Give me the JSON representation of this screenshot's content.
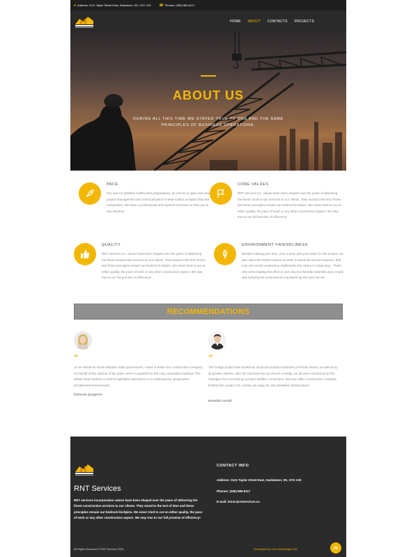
{
  "topbar": {
    "address": "Address: 3121 Taylor Street East, Saskatoon, SK, S7H 1X5",
    "phone": "Phones: (306) 880-8117"
  },
  "nav": {
    "items": [
      {
        "label": "HOME",
        "active": false
      },
      {
        "label": "ABOUT",
        "active": true
      },
      {
        "label": "CONTACTS",
        "active": false
      },
      {
        "label": "PROJECTS",
        "active": false
      }
    ]
  },
  "hero": {
    "title": "ABOUT US",
    "subtitle": "DURING ALL THIS TIME WE STAYED TRUE TO ONE AND THE SAME PRINCIPLES OF BUSINESS OPERATIONS."
  },
  "features": [
    {
      "title": "PACE",
      "icon": "rocket-icon",
      "text": "Our love for detailed, bullet-point preparations, as well as to open and clear project management and communication is what makes us faster than the competition. We have a professional and experienced team to help you in any situation."
    },
    {
      "title": "CORE VALUES",
      "icon": "flag-icon",
      "text": "RNT services Inc. values have been shaped over the years of delivering the finest construction services to our clients. They stood to the test of time and these principles remain our bedrock linchpins. We never tried to cut on either quality, the pace of work or any other construction aspect. We stay true to our full promise of efficiency!"
    },
    {
      "title": "QUALITY",
      "icon": "thumbs-up-icon",
      "text": "RNT services Inc. values have been shaped over the years of delivering the finest construction services to our clients. They stood to the test of time and these principles remain our bedrock linchpins. We never tried to cut on either quality, the pace of work or any other construction aspect. We stay true to our full promise of efficiency!"
    },
    {
      "title": "ENVIRONMENT FRIENDLINESS",
      "icon": "leaf-icon",
      "text": "Besides valuing your time, your money and your vision for the project, we also value the Mother Nature as well. It cannot be denied anymore, that even the small construction implements the nature in a bad way... That's why we're leading the effort to use only eco-friendly materials and comply with keeping the environment unpolluted by the work we do!"
    }
  ],
  "recommendations": {
    "heading": "RECOMMENDATIONS",
    "quote_mark": "“",
    "items": [
      {
        "text": "As an official fro North Dakota's state government, I want to thank Our construction company. On behalf of the citizens of the state, we're so grateful for this new, innovative building! This allows North Dakota to hold to legislative operations in a contemporary, progressive architectural environment!",
        "author": "Deborah Quagmire"
      },
      {
        "text": "This bridge project was funded by small and medium business of Rhode Island, as well as by its private citizens. After the hurricane hit our shores recently, we all were concerned for the Okaoppo river not having a proper landline connection. But now, after Construction company finished the project, the county can enjoy its new, beautiful infrastructure!",
        "author": "Benedict Arnold"
      }
    ]
  },
  "footer": {
    "brand": "RNT Services",
    "description": "RNT services incorporation values have been shaped over the years of delivering the finest construction services to our clients. They stood to the test of time and these principles remain our bedrock linchpins. We never tried to cut on either quality, the pace of work or any other construction aspect. We stay true to our full promise of efficiency!",
    "contact_title": "CONTACT INFO",
    "address": "Address: 3121 Taylor Street East, Saskatoon, SK, S7H 1X5",
    "phone": "Phones: (306) 880-8117",
    "email": "E-mail: imran@rntservices.ca",
    "copyright": "All Rights Reserved © RNT Services 2020.",
    "developer": "Developed By Leva Technologies Ltd."
  },
  "colors": {
    "accent": "#f2b705",
    "dark": "#2a2a2a",
    "rec_bar": "#8f8f8f"
  }
}
